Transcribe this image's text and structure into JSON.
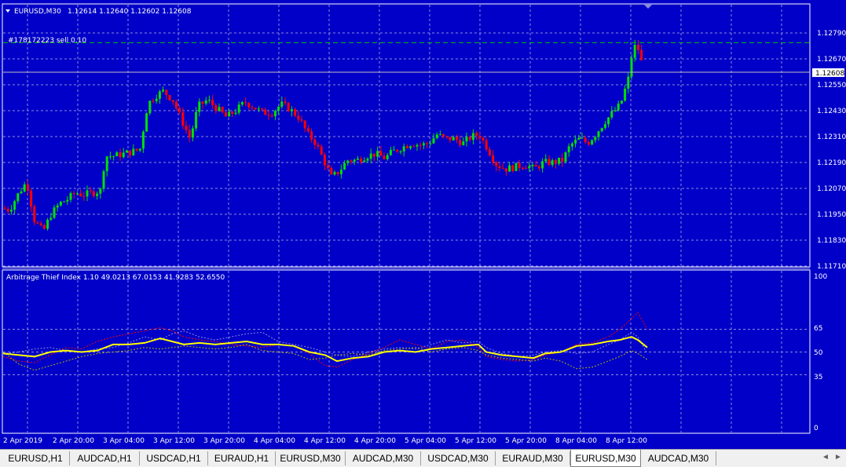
{
  "window": {
    "symbol_title": "EURUSD,M30",
    "ohlc": "1.12614 1.12640 1.12602 1.12608",
    "order_label": "#178172223 sell 0.10",
    "current_price": "1.12608"
  },
  "colors": {
    "background": "#0000c8",
    "grid": "#8c8cdc",
    "bull": "#00e000",
    "bear": "#ff0000",
    "main_line": "#ffff00",
    "sell_line": "#00c800"
  },
  "price_axis": {
    "labels": [
      "1.12790",
      "1.12670",
      "1.12550",
      "1.12430",
      "1.12310",
      "1.12190",
      "1.12070",
      "1.11950",
      "1.11830",
      "1.11710"
    ]
  },
  "indicator": {
    "title": "Arbitrage Thief Index 1.10 49.0213 67.0153 41.9283 52.6550",
    "levels": [
      "100",
      "65",
      "50",
      "35",
      "0"
    ]
  },
  "time_axis": {
    "labels": [
      "2 Apr 2019",
      "2 Apr 20:00",
      "3 Apr 04:00",
      "3 Apr 12:00",
      "3 Apr 20:00",
      "4 Apr 04:00",
      "4 Apr 12:00",
      "4 Apr 20:00",
      "5 Apr 04:00",
      "5 Apr 12:00",
      "5 Apr 20:00",
      "8 Apr 04:00",
      "8 Apr 12:00"
    ]
  },
  "chart_data": {
    "type": "candlestick",
    "ylim": [
      1.1171,
      1.1283
    ],
    "last_price": 1.12608,
    "sell_order_price": 1.12745,
    "close_path": [
      [
        0,
        1.1198
      ],
      [
        12,
        1.1197
      ],
      [
        24,
        1.1205
      ],
      [
        34,
        1.121
      ],
      [
        44,
        1.1192
      ],
      [
        55,
        1.1187
      ],
      [
        65,
        1.1195
      ],
      [
        76,
        1.12
      ],
      [
        86,
        1.1202
      ],
      [
        96,
        1.1205
      ],
      [
        106,
        1.1204
      ],
      [
        118,
        1.1205
      ],
      [
        128,
        1.1206
      ],
      [
        134,
        1.1222
      ],
      [
        145,
        1.1222
      ],
      [
        157,
        1.1223
      ],
      [
        168,
        1.1224
      ],
      [
        178,
        1.1225
      ],
      [
        188,
        1.1246
      ],
      [
        198,
        1.125
      ],
      [
        208,
        1.1252
      ],
      [
        220,
        1.1248
      ],
      [
        232,
        1.1238
      ],
      [
        242,
        1.123
      ],
      [
        252,
        1.1245
      ],
      [
        264,
        1.1248
      ],
      [
        276,
        1.1244
      ],
      [
        288,
        1.124
      ],
      [
        300,
        1.1243
      ],
      [
        312,
        1.1247
      ],
      [
        322,
        1.1245
      ],
      [
        334,
        1.1242
      ],
      [
        346,
        1.1242
      ],
      [
        358,
        1.1246
      ],
      [
        368,
        1.1244
      ],
      [
        380,
        1.124
      ],
      [
        392,
        1.1232
      ],
      [
        402,
        1.1228
      ],
      [
        412,
        1.122
      ],
      [
        422,
        1.1212
      ],
      [
        432,
        1.1215
      ],
      [
        442,
        1.122
      ],
      [
        454,
        1.122
      ],
      [
        466,
        1.1222
      ],
      [
        478,
        1.1223
      ],
      [
        490,
        1.1221
      ],
      [
        500,
        1.1224
      ],
      [
        512,
        1.1226
      ],
      [
        524,
        1.1228
      ],
      [
        536,
        1.1227
      ],
      [
        546,
        1.1228
      ],
      [
        556,
        1.1232
      ],
      [
        566,
        1.123
      ],
      [
        578,
        1.123
      ],
      [
        590,
        1.1228
      ],
      [
        600,
        1.1231
      ],
      [
        610,
        1.1232
      ],
      [
        620,
        1.1226
      ],
      [
        632,
        1.1218
      ],
      [
        644,
        1.1216
      ],
      [
        656,
        1.1217
      ],
      [
        668,
        1.1218
      ],
      [
        680,
        1.1216
      ],
      [
        692,
        1.1219
      ],
      [
        704,
        1.1219
      ],
      [
        716,
        1.122
      ],
      [
        726,
        1.1227
      ],
      [
        738,
        1.123
      ],
      [
        748,
        1.1228
      ],
      [
        758,
        1.1232
      ],
      [
        770,
        1.1238
      ],
      [
        780,
        1.1242
      ],
      [
        790,
        1.1246
      ],
      [
        800,
        1.1258
      ],
      [
        806,
        1.1273
      ],
      [
        812,
        1.1272
      ],
      [
        820,
        1.12608
      ]
    ],
    "indicator_series": [
      {
        "values": [
          [
            0,
            49
          ],
          [
            20,
            48
          ],
          [
            40,
            47
          ],
          [
            60,
            50
          ],
          [
            80,
            51
          ],
          [
            100,
            50
          ],
          [
            120,
            51
          ],
          [
            140,
            55
          ],
          [
            160,
            55
          ],
          [
            180,
            56
          ],
          [
            200,
            59
          ],
          [
            215,
            57
          ],
          [
            230,
            55
          ],
          [
            250,
            56
          ],
          [
            270,
            55
          ],
          [
            290,
            56
          ],
          [
            310,
            57
          ],
          [
            330,
            55
          ],
          [
            350,
            55
          ],
          [
            370,
            54
          ],
          [
            390,
            50
          ],
          [
            410,
            48
          ],
          [
            425,
            44
          ],
          [
            445,
            46
          ],
          [
            465,
            47
          ],
          [
            485,
            50
          ],
          [
            505,
            51
          ],
          [
            525,
            50
          ],
          [
            545,
            52
          ],
          [
            565,
            53
          ],
          [
            585,
            54
          ],
          [
            605,
            55
          ],
          [
            615,
            50
          ],
          [
            635,
            48
          ],
          [
            655,
            47
          ],
          [
            675,
            46
          ],
          [
            690,
            49
          ],
          [
            710,
            50
          ],
          [
            730,
            54
          ],
          [
            750,
            55
          ],
          [
            770,
            57
          ],
          [
            785,
            58
          ],
          [
            800,
            60
          ],
          [
            808,
            58
          ],
          [
            820,
            53
          ]
        ]
      },
      {
        "values": [
          [
            0,
            47
          ],
          [
            20,
            44
          ],
          [
            40,
            43
          ],
          [
            60,
            48
          ],
          [
            80,
            53
          ],
          [
            100,
            52
          ],
          [
            120,
            57
          ],
          [
            140,
            60
          ],
          [
            160,
            62
          ],
          [
            180,
            64
          ],
          [
            200,
            66
          ],
          [
            215,
            64
          ],
          [
            230,
            60
          ],
          [
            250,
            58
          ],
          [
            270,
            57
          ],
          [
            290,
            55
          ],
          [
            310,
            54
          ],
          [
            330,
            53
          ],
          [
            350,
            55
          ],
          [
            370,
            54
          ],
          [
            390,
            49
          ],
          [
            410,
            41
          ],
          [
            425,
            40
          ],
          [
            445,
            45
          ],
          [
            465,
            49
          ],
          [
            485,
            53
          ],
          [
            505,
            58
          ],
          [
            525,
            55
          ],
          [
            545,
            52
          ],
          [
            565,
            57
          ],
          [
            585,
            58
          ],
          [
            605,
            53
          ],
          [
            615,
            47
          ],
          [
            635,
            45
          ],
          [
            655,
            44
          ],
          [
            675,
            45
          ],
          [
            690,
            48
          ],
          [
            710,
            50
          ],
          [
            730,
            55
          ],
          [
            750,
            56
          ],
          [
            770,
            60
          ],
          [
            785,
            65
          ],
          [
            800,
            72
          ],
          [
            808,
            76
          ],
          [
            820,
            65
          ]
        ]
      },
      {
        "values": [
          [
            0,
            49
          ],
          [
            20,
            50
          ],
          [
            40,
            52
          ],
          [
            60,
            53
          ],
          [
            80,
            51
          ],
          [
            100,
            50
          ],
          [
            120,
            52
          ],
          [
            140,
            53
          ],
          [
            160,
            56
          ],
          [
            180,
            60
          ],
          [
            200,
            58
          ],
          [
            215,
            62
          ],
          [
            230,
            64
          ],
          [
            250,
            60
          ],
          [
            270,
            58
          ],
          [
            290,
            60
          ],
          [
            310,
            62
          ],
          [
            330,
            63
          ],
          [
            350,
            57
          ],
          [
            370,
            55
          ],
          [
            390,
            53
          ],
          [
            410,
            50
          ],
          [
            425,
            48
          ],
          [
            445,
            47
          ],
          [
            465,
            50
          ],
          [
            485,
            52
          ],
          [
            505,
            53
          ],
          [
            525,
            52
          ],
          [
            545,
            55
          ],
          [
            565,
            58
          ],
          [
            585,
            56
          ],
          [
            605,
            57
          ],
          [
            615,
            53
          ],
          [
            635,
            49
          ],
          [
            655,
            47
          ],
          [
            675,
            48
          ],
          [
            690,
            50
          ],
          [
            710,
            51
          ],
          [
            730,
            49
          ],
          [
            750,
            50
          ],
          [
            770,
            55
          ],
          [
            785,
            58
          ],
          [
            800,
            63
          ],
          [
            808,
            60
          ],
          [
            820,
            49
          ]
        ]
      },
      {
        "values": [
          [
            0,
            50
          ],
          [
            20,
            42
          ],
          [
            40,
            38
          ],
          [
            60,
            41
          ],
          [
            80,
            44
          ],
          [
            100,
            47
          ],
          [
            120,
            49
          ],
          [
            140,
            50
          ],
          [
            160,
            51
          ],
          [
            180,
            53
          ],
          [
            200,
            52
          ],
          [
            215,
            53
          ],
          [
            230,
            54
          ],
          [
            250,
            53
          ],
          [
            270,
            52
          ],
          [
            290,
            53
          ],
          [
            310,
            55
          ],
          [
            330,
            51
          ],
          [
            350,
            50
          ],
          [
            370,
            49
          ],
          [
            390,
            45
          ],
          [
            410,
            46
          ],
          [
            425,
            48
          ],
          [
            445,
            49
          ],
          [
            465,
            48
          ],
          [
            485,
            51
          ],
          [
            505,
            52
          ],
          [
            525,
            53
          ],
          [
            545,
            50
          ],
          [
            565,
            52
          ],
          [
            585,
            53
          ],
          [
            605,
            51
          ],
          [
            615,
            48
          ],
          [
            635,
            46
          ],
          [
            655,
            45
          ],
          [
            675,
            44
          ],
          [
            690,
            46
          ],
          [
            710,
            44
          ],
          [
            730,
            39
          ],
          [
            750,
            40
          ],
          [
            770,
            44
          ],
          [
            785,
            47
          ],
          [
            800,
            51
          ],
          [
            808,
            49
          ],
          [
            820,
            45
          ]
        ]
      }
    ]
  },
  "tabs": [
    {
      "label": "EURUSD,H1"
    },
    {
      "label": "AUDCAD,H1"
    },
    {
      "label": "USDCAD,H1"
    },
    {
      "label": "EURAUD,H1"
    },
    {
      "label": "EURUSD,M30"
    },
    {
      "label": "AUDCAD,M30"
    },
    {
      "label": "USDCAD,M30"
    },
    {
      "label": "EURAUD,M30"
    },
    {
      "label": "EURUSD,M30",
      "active": true
    },
    {
      "label": "AUDCAD,M30"
    }
  ],
  "scroll": {
    "left": "◄",
    "right": "►"
  }
}
